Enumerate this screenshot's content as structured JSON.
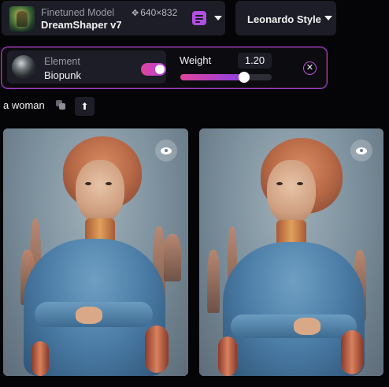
{
  "model": {
    "kind_label": "Finetuned Model",
    "name": "DreamShaper v7",
    "resolution": "640×832",
    "resolution_icon": "move-arrows-icon",
    "layers_icon": "layers-icon",
    "dropdown_icon": "caret-down-icon"
  },
  "style": {
    "label": "Leonardo Style",
    "dropdown_icon": "caret-down-icon"
  },
  "element": {
    "title": "Element",
    "name": "Biopunk",
    "enabled": true,
    "weight_label": "Weight",
    "weight_value": "1.20",
    "slider_fraction": 0.7,
    "remove_icon": "close-icon"
  },
  "prompt": {
    "text": "a woman",
    "copy_icon": "copy-icon",
    "upload_icon": "arrow-up-icon"
  },
  "images": [
    {
      "label": "generated-image-1",
      "view_icon": "eye-icon"
    },
    {
      "label": "generated-image-2",
      "view_icon": "eye-icon"
    }
  ],
  "colors": {
    "background": "#050507",
    "card": "#1c1d26",
    "accent_pink": "#e0449a",
    "accent_purple": "#b342e6"
  }
}
